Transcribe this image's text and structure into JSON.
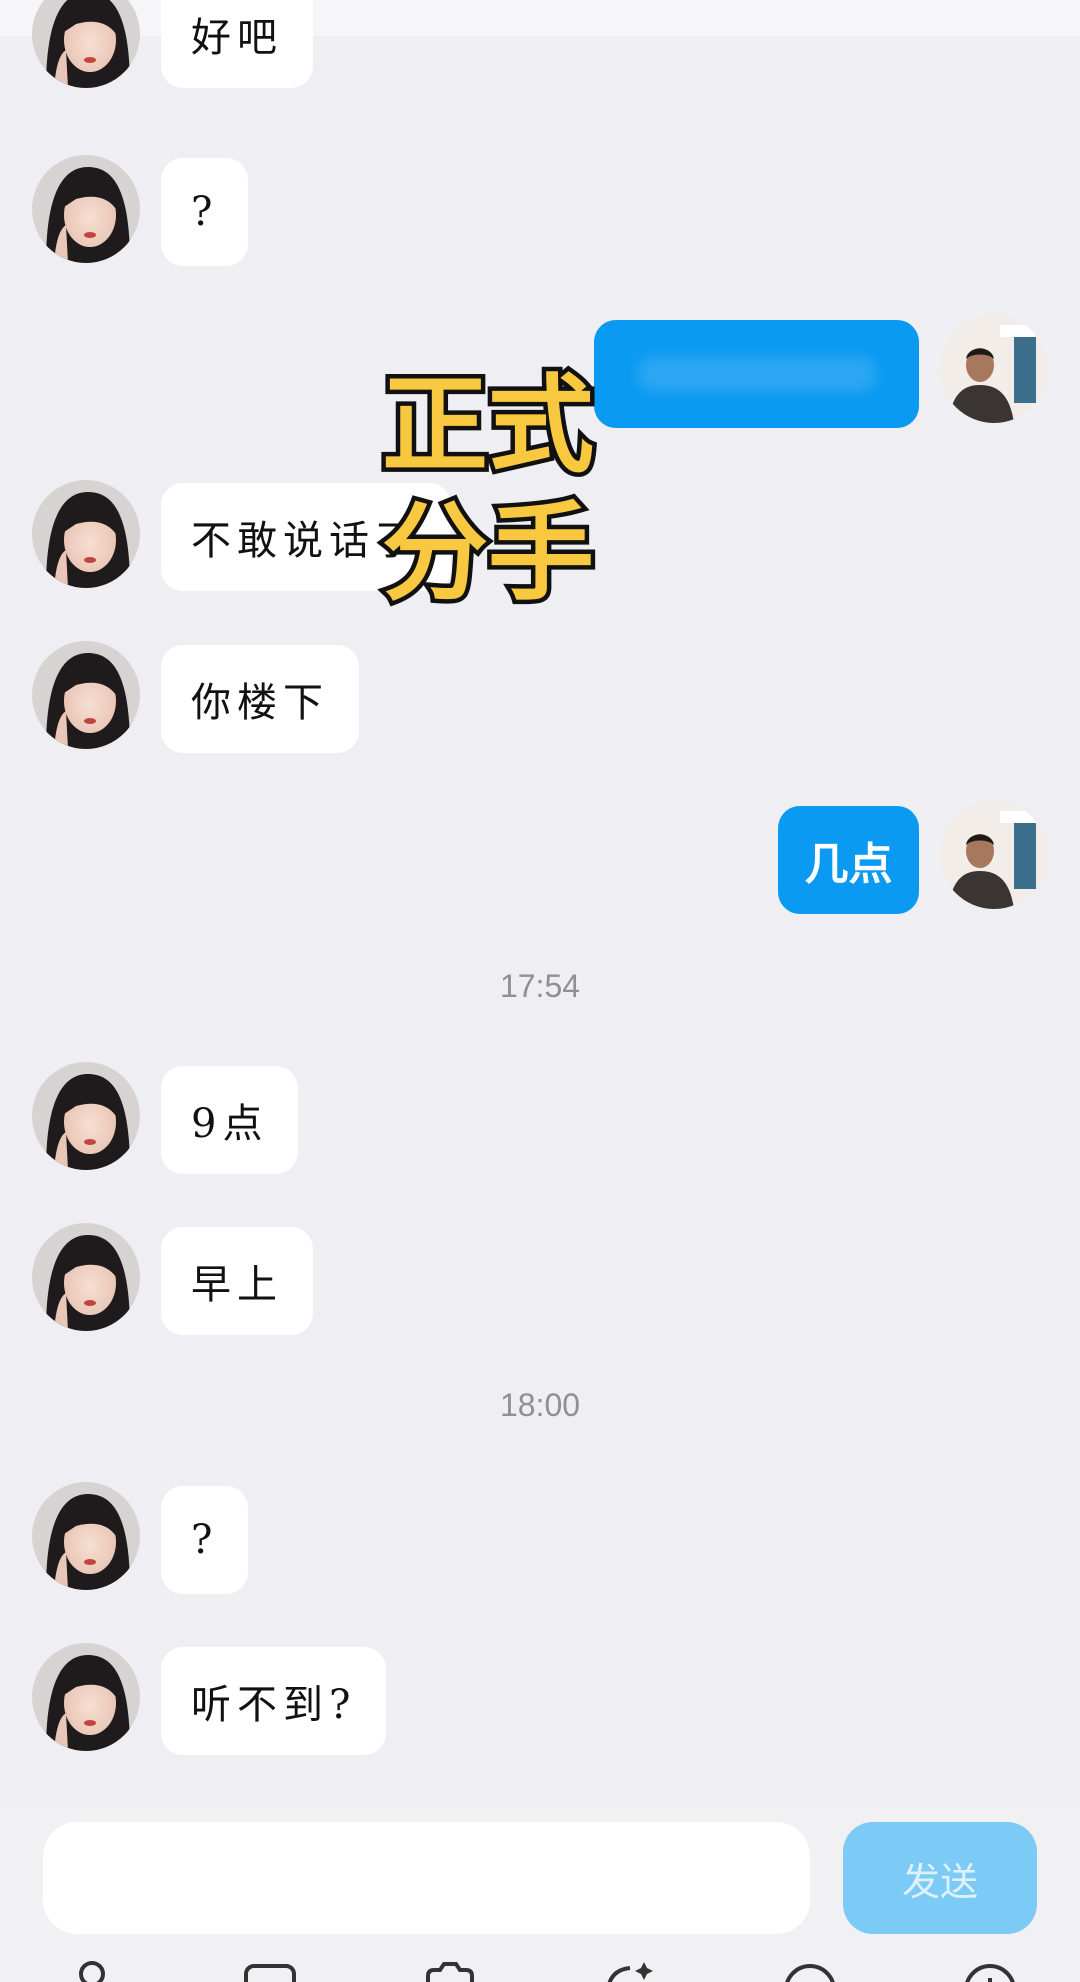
{
  "messages": [
    {
      "side": "left",
      "text": "好吧"
    },
    {
      "side": "left",
      "text": "?"
    },
    {
      "side": "right",
      "text": "",
      "blurred": true
    },
    {
      "side": "left",
      "text": "不敢说话了"
    },
    {
      "side": "left",
      "text": "你楼下"
    },
    {
      "side": "right",
      "text": "几点"
    },
    {
      "side": "left",
      "text": "9点"
    },
    {
      "side": "left",
      "text": "早上"
    },
    {
      "side": "left",
      "text": "?"
    },
    {
      "side": "left",
      "text": "听不到?"
    }
  ],
  "timestamps": [
    "17:54",
    "18:00"
  ],
  "overlay": {
    "line1": "正式",
    "line2": "分手"
  },
  "input": {
    "value": "",
    "placeholder": ""
  },
  "send_label": "发送",
  "colors": {
    "background": "#efeff3",
    "left_bubble": "#ffffff",
    "right_bubble": "#0a9af2",
    "send_button": "#7ccaf6",
    "overlay_text": "#f8c940"
  },
  "toolbar_icons": [
    "user-icon",
    "image-icon",
    "camera-icon",
    "sparkle-icon",
    "emoji-icon",
    "plus-icon"
  ]
}
